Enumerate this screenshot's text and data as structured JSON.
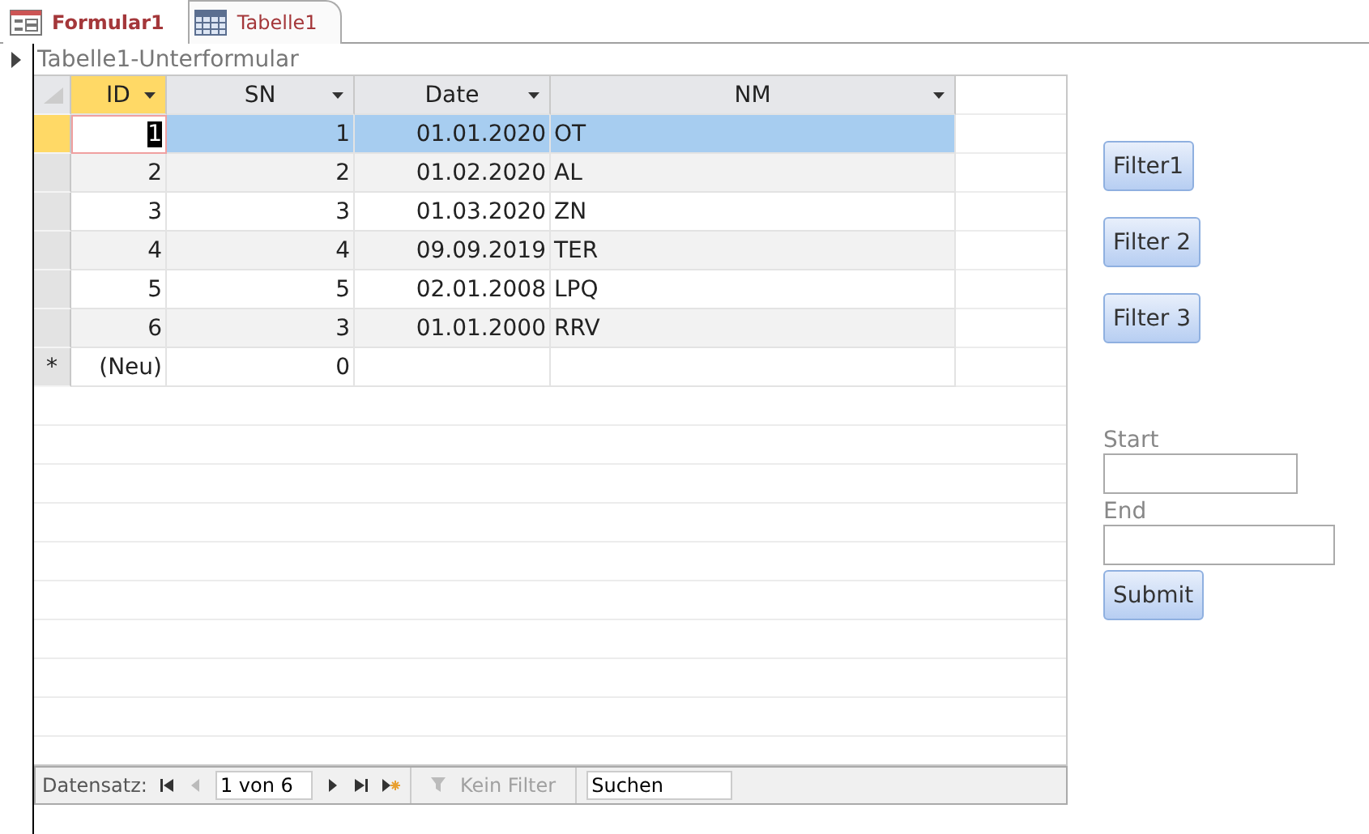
{
  "tabs": [
    {
      "label": "Formular1",
      "kind": "form",
      "selected": true
    },
    {
      "label": "Tabelle1",
      "kind": "table",
      "selected": false
    }
  ],
  "subform": {
    "title": "Tabelle1-Unterformular",
    "columns": [
      {
        "label": "ID",
        "selected": true
      },
      {
        "label": "SN",
        "selected": false
      },
      {
        "label": "Date",
        "selected": false
      },
      {
        "label": "NM",
        "selected": false
      }
    ],
    "rows": [
      {
        "cells": [
          "1",
          "1",
          "01.01.2020",
          "OT"
        ],
        "selected": true
      },
      {
        "cells": [
          "2",
          "2",
          "01.02.2020",
          "AL"
        ],
        "selected": false
      },
      {
        "cells": [
          "3",
          "3",
          "01.03.2020",
          "ZN"
        ],
        "selected": false
      },
      {
        "cells": [
          "4",
          "4",
          "09.09.2019",
          "TER"
        ],
        "selected": false
      },
      {
        "cells": [
          "5",
          "5",
          "02.01.2008",
          "LPQ"
        ],
        "selected": false
      },
      {
        "cells": [
          "6",
          "3",
          "01.01.2000",
          "RRV"
        ],
        "selected": false
      }
    ],
    "new_row": {
      "marker": "*",
      "cells": [
        "(Neu)",
        "0",
        "",
        ""
      ]
    },
    "navigation": {
      "label": "Datensatz:",
      "record": "1 von 6",
      "filter": "Kein Filter",
      "filter_disabled": true,
      "placeholder": "Suchen"
    }
  },
  "buttons": [
    "Filter1",
    "Filter 2",
    "Filter 3"
  ],
  "fields": [
    {
      "label": "Start",
      "kind": "short"
    },
    {
      "label": "End",
      "kind": "long"
    }
  ],
  "submit": "Submit"
}
